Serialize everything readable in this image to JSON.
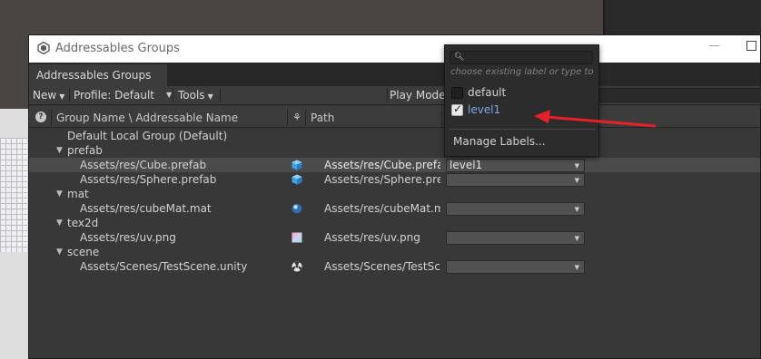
{
  "window": {
    "title": "Addressables Groups",
    "tab": "Addressables Groups",
    "minimize_glyph": "—"
  },
  "toolbar": {
    "new_label": "New",
    "profile_label": "Profile: Default",
    "tools_label": "Tools",
    "play_mode_label": "Play Mode"
  },
  "header": {
    "help_glyph": "?",
    "col_name": "Group Name \\ Addressable Name",
    "col_path": "Path"
  },
  "tree": {
    "group": "Default Local Group (Default)",
    "folders": {
      "prefab": "prefab",
      "mat": "mat",
      "tex2d": "tex2d",
      "scene": "scene"
    },
    "entries": [
      {
        "name": "Assets/res/Cube.prefab",
        "path": "Assets/res/Cube.prefab",
        "labels": "level1",
        "icon": "prefab-icon"
      },
      {
        "name": "Assets/res/Sphere.prefab",
        "path": "Assets/res/Sphere.prefab",
        "labels": "",
        "icon": "prefab-icon"
      },
      {
        "name": "Assets/res/cubeMat.mat",
        "path": "Assets/res/cubeMat.mat",
        "labels": "",
        "icon": "material-icon"
      },
      {
        "name": "Assets/res/uv.png",
        "path": "Assets/res/uv.png",
        "labels": "",
        "icon": "texture-icon"
      },
      {
        "name": "Assets/Scenes/TestScene.unity",
        "path": "Assets/Scenes/TestScene.unity",
        "labels": "",
        "icon": "scene-icon"
      }
    ]
  },
  "popup": {
    "hint": "choose existing label or type to c",
    "options": [
      {
        "label": "default",
        "checked": false
      },
      {
        "label": "level1",
        "checked": true
      }
    ],
    "manage": "Manage Labels..."
  },
  "colors": {
    "annotation_arrow": "#e8202a",
    "selected_label": "#7ea6e6"
  }
}
